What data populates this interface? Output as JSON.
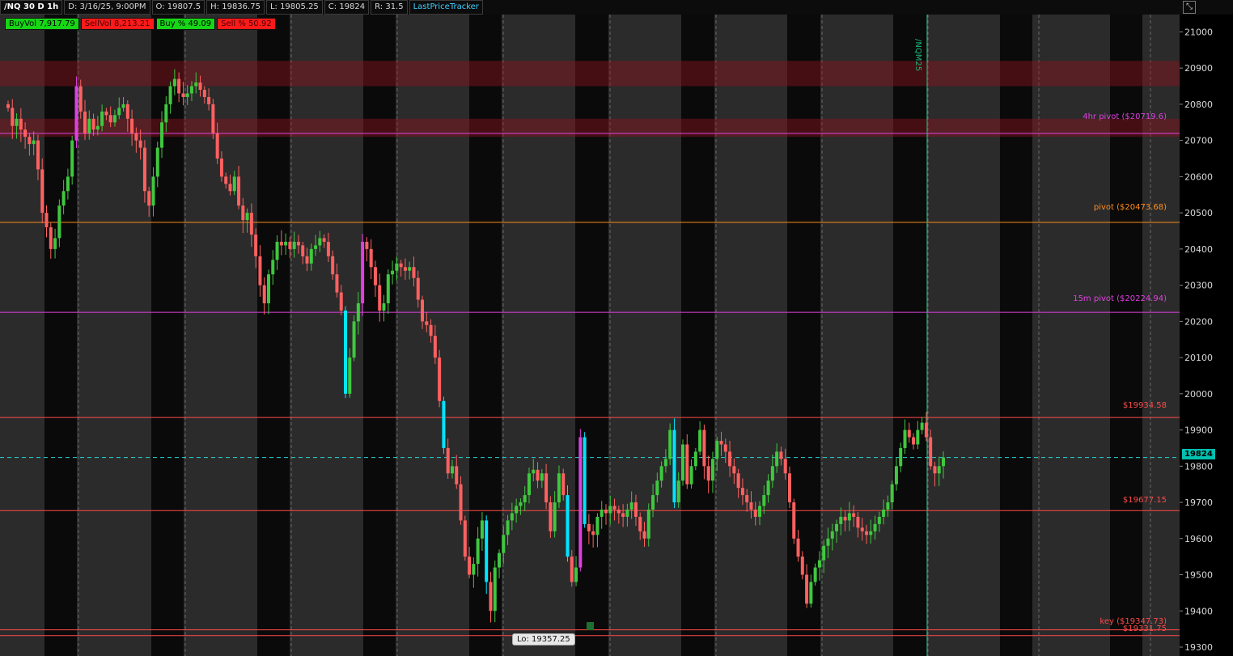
{
  "header": {
    "symbol": "/NQ 30 D 1h",
    "date": "D: 3/16/25, 9:00PM",
    "open": "O: 19807.5",
    "high": "H: 19836.75",
    "low": "L: 19805.25",
    "close": "C: 19824",
    "range": "R: 31.5",
    "tracker": "LastPriceTracker"
  },
  "stats": {
    "buyvol": "BuyVol 7,917.79",
    "sellvol": "SellVol 8,213.21",
    "buypct": "Buy % 49.09",
    "sellpct": "Sell % 50.92"
  },
  "labels": {
    "pivot4h": "4hr pivot ($20719.6)",
    "pivot": "pivot ($20473.68)",
    "pivot15m": "15m pivot ($20224.94)",
    "level1": "$19934.58",
    "level2": "$19677.15",
    "key": "key ($19347.73)",
    "level3": "$19331.75",
    "lo": "Lo: 19357.25",
    "price_tag": "19824",
    "contract": "/NQM25"
  },
  "chart_data": {
    "type": "candlestick",
    "ylim": [
      19300,
      21030
    ],
    "yticks": [
      19300,
      19400,
      19500,
      19600,
      19700,
      19800,
      19900,
      20000,
      20100,
      20200,
      20300,
      20400,
      20500,
      20600,
      20700,
      20800,
      20900,
      21000
    ],
    "last_price": 19824,
    "horizontal_lines": [
      {
        "label": "4hr pivot ($20719.6)",
        "value": 20719.6,
        "color": "#e040e0"
      },
      {
        "label": "pivot ($20473.68)",
        "value": 20473.68,
        "color": "#ff8c1a"
      },
      {
        "label": "15m pivot ($20224.94)",
        "value": 20224.94,
        "color": "#e040e0"
      },
      {
        "label": "$19934.58",
        "value": 19934.58,
        "color": "#ff4a4a"
      },
      {
        "label": "$19677.15",
        "value": 19677.15,
        "color": "#ff4a4a"
      },
      {
        "label": "key ($19347.73)",
        "value": 19347.73,
        "color": "#ff4a4a"
      },
      {
        "label": "$19331.75",
        "value": 19331.75,
        "color": "#ff4a4a"
      }
    ],
    "resistance_zones": [
      [
        20850,
        20920
      ],
      [
        20710,
        20760
      ]
    ],
    "closes": [
      20790,
      20740,
      20760,
      20730,
      20710,
      20690,
      20700,
      20620,
      20500,
      20460,
      20400,
      20430,
      20520,
      20560,
      20600,
      20700,
      20850,
      20780,
      20720,
      20760,
      20730,
      20740,
      20780,
      20770,
      20750,
      20770,
      20790,
      20800,
      20760,
      20720,
      20700,
      20680,
      20560,
      20520,
      20600,
      20680,
      20750,
      20800,
      20850,
      20870,
      20830,
      20820,
      20830,
      20850,
      20860,
      20840,
      20820,
      20800,
      20720,
      20650,
      20600,
      20580,
      20560,
      20600,
      20520,
      20480,
      20500,
      20440,
      20380,
      20300,
      20250,
      20330,
      20370,
      20420,
      20410,
      20420,
      20400,
      20420,
      20410,
      20380,
      20360,
      20400,
      20410,
      20430,
      20420,
      20380,
      20330,
      20280,
      20230,
      20000,
      20100,
      20200,
      20250,
      20420,
      20400,
      20350,
      20300,
      20230,
      20250,
      20330,
      20340,
      20360,
      20350,
      20340,
      20350,
      20320,
      20260,
      20200,
      20190,
      20160,
      20100,
      19980,
      19850,
      19780,
      19800,
      19750,
      19650,
      19550,
      19500,
      19530,
      19600,
      19650,
      19480,
      19400,
      19520,
      19560,
      19610,
      19650,
      19670,
      19690,
      19700,
      19720,
      19780,
      19790,
      19760,
      19780,
      19700,
      19620,
      19700,
      19780,
      19720,
      19550,
      19480,
      19520,
      19880,
      19640,
      19620,
      19610,
      19660,
      19680,
      19670,
      19690,
      19680,
      19670,
      19660,
      19680,
      19700,
      19660,
      19620,
      19600,
      19680,
      19720,
      19760,
      19800,
      19820,
      19900,
      19700,
      19760,
      19860,
      19750,
      19800,
      19840,
      19900,
      19800,
      19760,
      19820,
      19870,
      19860,
      19840,
      19800,
      19780,
      19740,
      19720,
      19700,
      19680,
      19660,
      19690,
      19720,
      19760,
      19800,
      19840,
      19820,
      19780,
      19700,
      19600,
      19550,
      19500,
      19420,
      19480,
      19520,
      19540,
      19580,
      19600,
      19620,
      19640,
      19660,
      19650,
      19670,
      19660,
      19630,
      19620,
      19610,
      19620,
      19640,
      19660,
      19680,
      19700,
      19750,
      19800,
      19850,
      19900,
      19880,
      19860,
      19900,
      19920,
      19880,
      19800,
      19780,
      19800,
      19824
    ]
  }
}
